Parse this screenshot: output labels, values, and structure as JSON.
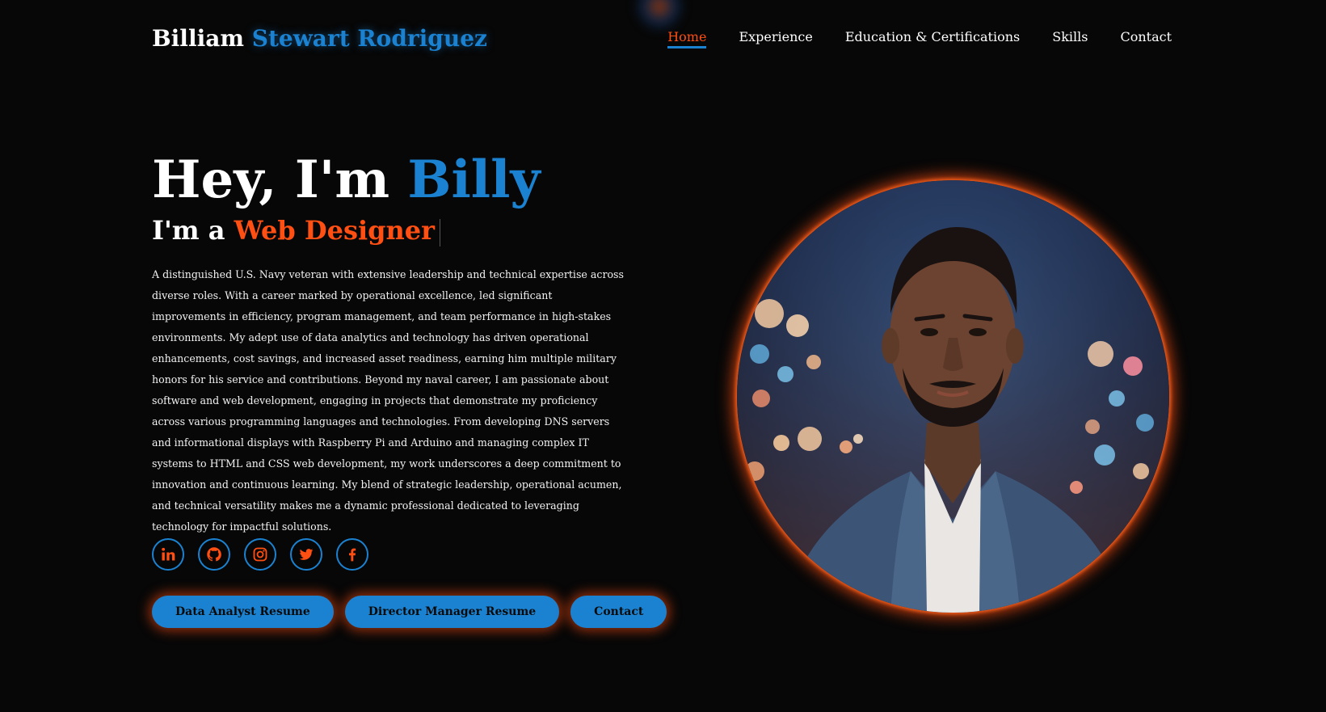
{
  "header": {
    "logo_first": "Billiam",
    "logo_last": "Stewart Rodriguez",
    "nav": [
      {
        "label": "Home",
        "active": true
      },
      {
        "label": "Experience",
        "active": false
      },
      {
        "label": "Education & Certifications",
        "active": false
      },
      {
        "label": "Skills",
        "active": false
      },
      {
        "label": "Contact",
        "active": false
      }
    ]
  },
  "hero": {
    "greeting": "Hey, I'm ",
    "name": "Billy",
    "role_prefix": "I'm a ",
    "role": "Web Designer",
    "bio": "A distinguished U.S. Navy veteran with extensive leadership and technical expertise across diverse roles. With a career marked by operational excellence, led significant improvements in efficiency, program management, and team performance in high-stakes environments. My adept use of data analytics and technology has driven operational enhancements, cost savings, and increased asset readiness, earning him multiple military honors for his service and contributions. Beyond my naval career, I am passionate about software and web development, engaging in projects that demonstrate my proficiency across various programming languages and technologies. From developing DNS servers and informational displays with Raspberry Pi and Arduino and managing complex IT systems to HTML and CSS web development, my work underscores a deep commitment to innovation and continuous learning. My blend of strategic leadership, operational acumen, and technical versatility makes me a dynamic professional dedicated to leveraging technology for impactful solutions."
  },
  "socials": [
    {
      "icon": "linkedin-icon"
    },
    {
      "icon": "github-icon"
    },
    {
      "icon": "instagram-icon"
    },
    {
      "icon": "twitter-icon"
    },
    {
      "icon": "facebook-icon"
    }
  ],
  "buttons": {
    "data_analyst": "Data Analyst Resume",
    "director_manager": "Director Manager Resume",
    "contact": "Contact"
  },
  "colors": {
    "background": "#070707",
    "accent_blue": "#1b82d1",
    "accent_orange": "#ff4f12"
  }
}
